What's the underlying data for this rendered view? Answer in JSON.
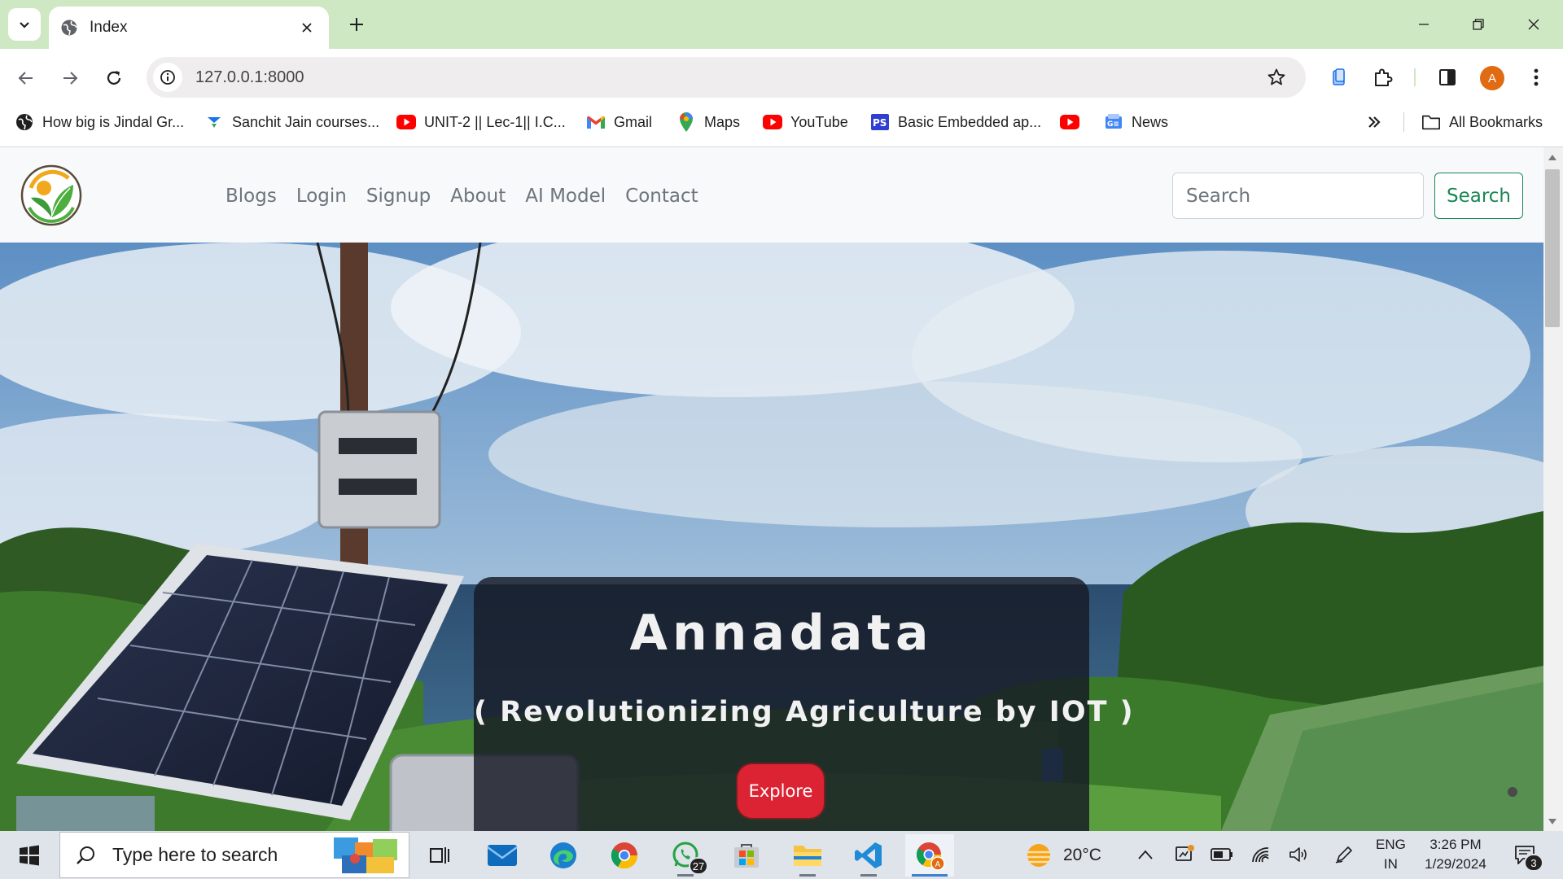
{
  "browser": {
    "tab": {
      "title": "Index"
    },
    "omnibox": {
      "url": "127.0.0.1:8000"
    },
    "profile_initial": "A",
    "bookmarks": [
      {
        "label": "How big is Jindal Gr...",
        "icon": "globe-dark-icon"
      },
      {
        "label": "Sanchit Jain courses...",
        "icon": "courses-icon"
      },
      {
        "label": "UNIT-2 || Lec-1|| I.C...",
        "icon": "youtube-icon"
      },
      {
        "label": "Gmail",
        "icon": "gmail-icon"
      },
      {
        "label": "Maps",
        "icon": "maps-icon"
      },
      {
        "label": "YouTube",
        "icon": "youtube-icon"
      },
      {
        "label": "Basic Embedded ap...",
        "icon": "ps-icon"
      },
      {
        "label": "",
        "icon": "youtube-icon"
      },
      {
        "label": "News",
        "icon": "news-icon"
      }
    ],
    "all_bookmarks_label": "All Bookmarks"
  },
  "site": {
    "nav_links": [
      "Blogs",
      "Login",
      "Signup",
      "About",
      "AI Model",
      "Contact"
    ],
    "search": {
      "placeholder": "Search",
      "button_label": "Search"
    },
    "hero": {
      "title": "Annadata",
      "subtitle": "( Revolutionizing Agriculture by IOT )",
      "button_label": "Explore"
    }
  },
  "taskbar": {
    "search_placeholder": "Type here to search",
    "whatsapp_badge": "27",
    "weather": "20°C",
    "lang_line1": "ENG",
    "lang_line2": "IN",
    "time": "3:26 PM",
    "date": "1/29/2024",
    "notifications": "3"
  },
  "colors": {
    "tabstrip": "#cfe8c4",
    "search_button": "#198754",
    "explore_button": "#dc2333",
    "profile": "#e06b12"
  }
}
